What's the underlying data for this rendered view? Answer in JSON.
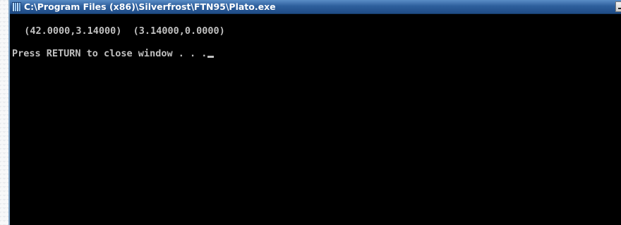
{
  "window": {
    "title": "C:\\Program Files (x86)\\Silverfrost\\FTN95\\Plato.exe",
    "icon": "console-app-icon"
  },
  "console": {
    "lines": [
      "  (42.0000,3.14000)  (3.14000,0.0000)",
      "Press RETURN to close window . . ."
    ],
    "cursor": "_"
  },
  "colors": {
    "titlebar": "#2e5f9c",
    "console_bg": "#000000",
    "console_fg": "#c0c0c0"
  }
}
